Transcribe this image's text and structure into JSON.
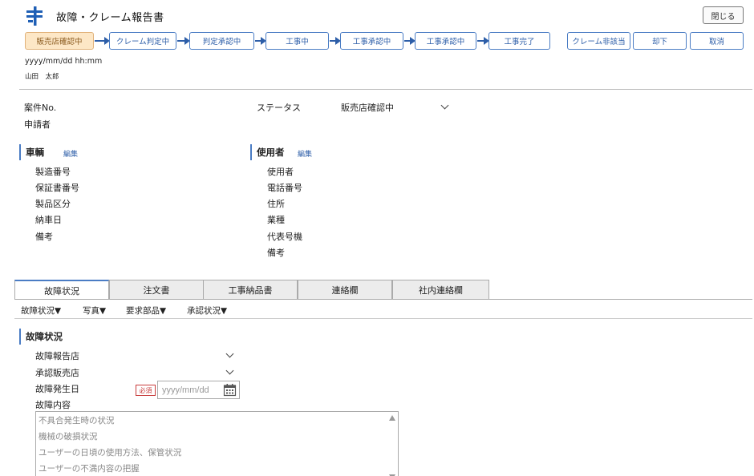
{
  "header": {
    "title": "故障・クレーム報告書",
    "close_label": "閉じる"
  },
  "workflow": {
    "steps": [
      "販売店確認中",
      "クレーム判定中",
      "判定承認中",
      "工事中",
      "工事承認中",
      "工事承認中",
      "工事完了"
    ],
    "active_step": "販売店確認中",
    "actions": [
      "クレーム非該当",
      "却下",
      "取消"
    ]
  },
  "meta": {
    "datetime": "yyyy/mm/dd hh:mm",
    "user": "山田　太郎"
  },
  "case": {
    "case_no_label": "案件No.",
    "applicant_label": "申請者",
    "status_label": "ステータス",
    "status_value": "販売店確認中"
  },
  "vehicle": {
    "title": "車輌",
    "edit_label": "編集",
    "fields": [
      "製造番号",
      "保証書番号",
      "製品区分",
      "納車日",
      "備考"
    ]
  },
  "user_section": {
    "title": "使用者",
    "edit_label": "編集",
    "fields": [
      "使用者",
      "電話番号",
      "住所",
      "業種",
      "代表号機",
      "備考"
    ]
  },
  "tabs": [
    "故障状況",
    "注文書",
    "工事納品書",
    "連絡欄",
    "社内連絡欄"
  ],
  "active_tab": "故障状況",
  "subnav": [
    "故障状況▼",
    "写真▼",
    "要求部品▼",
    "承認状況▼"
  ],
  "fault": {
    "section_title": "故障状況",
    "report_store_label": "故障報告店",
    "approval_store_label": "承認販売店",
    "date_label": "故障発生日",
    "required_badge": "必須",
    "date_placeholder": "yyyy/mm/dd",
    "content_label": "故障内容",
    "content_lines": [
      "不具合発生時の状況",
      "機械の破損状況",
      "ユーザーの日頃の使用方法、保管状況",
      "ユーザーの不満内容の把握"
    ]
  },
  "colors": {
    "accent": "#2d5ea8",
    "active_step_bg": "#fde7c6",
    "required": "#c83c3c"
  }
}
